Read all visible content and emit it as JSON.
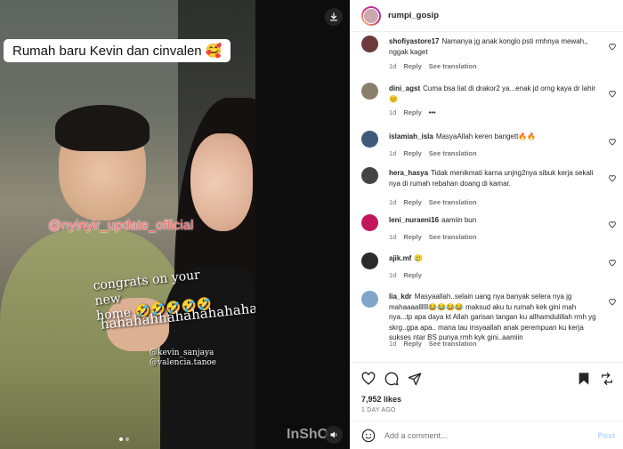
{
  "post": {
    "username": "rumpi_gosip",
    "more_label": "•••"
  },
  "media": {
    "caption_box": "Rumah baru Kevin dan cinvalen 🥰",
    "watermark": "@nyinyir_update_official",
    "congrats_line1": "congrats on your new",
    "congrats_line2": "home 🤣🤣🤣🤣🤣",
    "haha": "hahahahhahahahahaha",
    "tag1": "@kevin_sanjaya",
    "tag2": "@valencia.tanoe",
    "inshot": "InShO",
    "download_icon": "download-icon",
    "mute_icon": "speaker-icon",
    "carousel_active_index": 1
  },
  "comments": [
    {
      "user": "shofiyastore17",
      "text": "Namanya jg anak konglo psti rmhnya mewah,, nggak kaget",
      "time": "1d",
      "reply": "Reply",
      "translate": "See translation",
      "avatar_color": "#6b3b3b"
    },
    {
      "user": "dini_agst",
      "text": "Cuma bsa liat di drakor2 ya...enak jd orng kaya dr lahir 😊",
      "time": "1d",
      "reply": "Reply",
      "translate": "",
      "more": "•••",
      "avatar_color": "#8a7f6b"
    },
    {
      "user": "islamiah_isla",
      "text": "MasyaAllah keren bangett🔥🔥",
      "time": "1d",
      "reply": "Reply",
      "translate": "See translation",
      "avatar_color": "#3e5a7a"
    },
    {
      "user": "hera_hasya",
      "text": "Tidak menikmati karna unjng2nya sibuk kerja sekali nya di rumah rebahan doang di kamar.",
      "time": "1d",
      "reply": "Reply",
      "translate": "See translation",
      "avatar_color": "#444444"
    },
    {
      "user": "leni_nuraeni16",
      "text": "aamiin bun",
      "time": "1d",
      "reply": "Reply",
      "translate": "See translation",
      "avatar_color": "#c2185b"
    },
    {
      "user": "ajik.mf",
      "text": "🥲",
      "time": "1d",
      "reply": "Reply",
      "translate": "",
      "avatar_color": "#2b2b2b"
    },
    {
      "user": "lia_kdr",
      "text": "Masyaallah..selain uang nya banyak selera nya jg mahaaaallllll😂😂😂😂 maksud aku tu rumah kek gini mah nya...tp apa daya kt Allah garisan tangan ku allhamdulillah rmh yg skrg..gpa apa.. mana tau insyaallah anak perempuan ku kerja sukses ntar BS punya rmh kyk gini..aamiin",
      "time": "1d",
      "reply": "Reply",
      "translate": "See translation",
      "avatar_color": "#7fa6c8"
    }
  ],
  "actions": {
    "likes": "7,952 likes",
    "ago": "1 day ago",
    "comment_placeholder": "Add a comment...",
    "post_label": "Post"
  },
  "colors": {
    "text": "#262626",
    "muted": "#737373",
    "post_disabled": "#b3dbff",
    "border": "#efefef"
  }
}
